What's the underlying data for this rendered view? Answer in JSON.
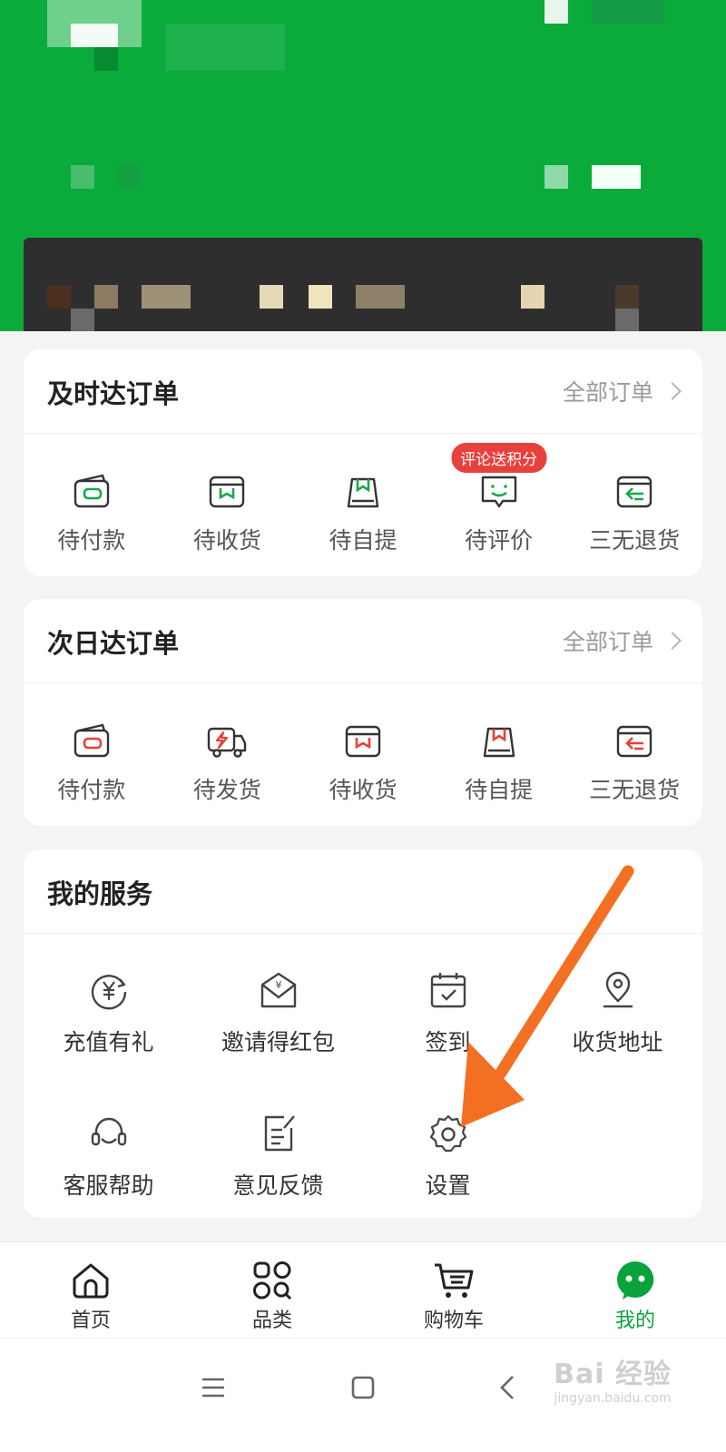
{
  "colors": {
    "brand": "#0aaa3b",
    "accent_red": "#e8403c",
    "arrow": "#f36f21",
    "active_tab": "#0aa33b"
  },
  "express_orders": {
    "title": "及时达订单",
    "all_link": "全部订单",
    "items": [
      {
        "label": "待付款",
        "icon": "wallet-icon"
      },
      {
        "label": "待收货",
        "icon": "parcel-icon"
      },
      {
        "label": "待自提",
        "icon": "bag-icon"
      },
      {
        "label": "待评价",
        "icon": "review-icon",
        "badge": "评论送积分"
      },
      {
        "label": "三无退货",
        "icon": "return-icon"
      }
    ]
  },
  "nextday_orders": {
    "title": "次日达订单",
    "all_link": "全部订单",
    "items": [
      {
        "label": "待付款",
        "icon": "wallet-icon"
      },
      {
        "label": "待发货",
        "icon": "truck-icon"
      },
      {
        "label": "待收货",
        "icon": "parcel-icon"
      },
      {
        "label": "待自提",
        "icon": "bag-icon"
      },
      {
        "label": "三无退货",
        "icon": "return-icon"
      }
    ]
  },
  "services": {
    "title": "我的服务",
    "items": [
      {
        "label": "充值有礼",
        "icon": "recharge-icon"
      },
      {
        "label": "邀请得红包",
        "icon": "red-envelope-icon"
      },
      {
        "label": "签到",
        "icon": "calendar-icon"
      },
      {
        "label": "收货地址",
        "icon": "location-icon"
      },
      {
        "label": "客服帮助",
        "icon": "headset-icon"
      },
      {
        "label": "意见反馈",
        "icon": "feedback-icon"
      },
      {
        "label": "设置",
        "icon": "gear-icon"
      }
    ]
  },
  "tabbar": {
    "items": [
      {
        "label": "首页",
        "icon": "home-icon",
        "active": false
      },
      {
        "label": "品类",
        "icon": "category-icon",
        "active": false
      },
      {
        "label": "购物车",
        "icon": "cart-icon",
        "active": false
      },
      {
        "label": "我的",
        "icon": "profile-icon",
        "active": true
      }
    ]
  },
  "system_nav": {
    "buttons": [
      "menu-icon",
      "home-square-icon",
      "back-icon"
    ]
  },
  "watermark": {
    "main": "Bai 经验",
    "sub": "jingyan.baidu.com"
  }
}
